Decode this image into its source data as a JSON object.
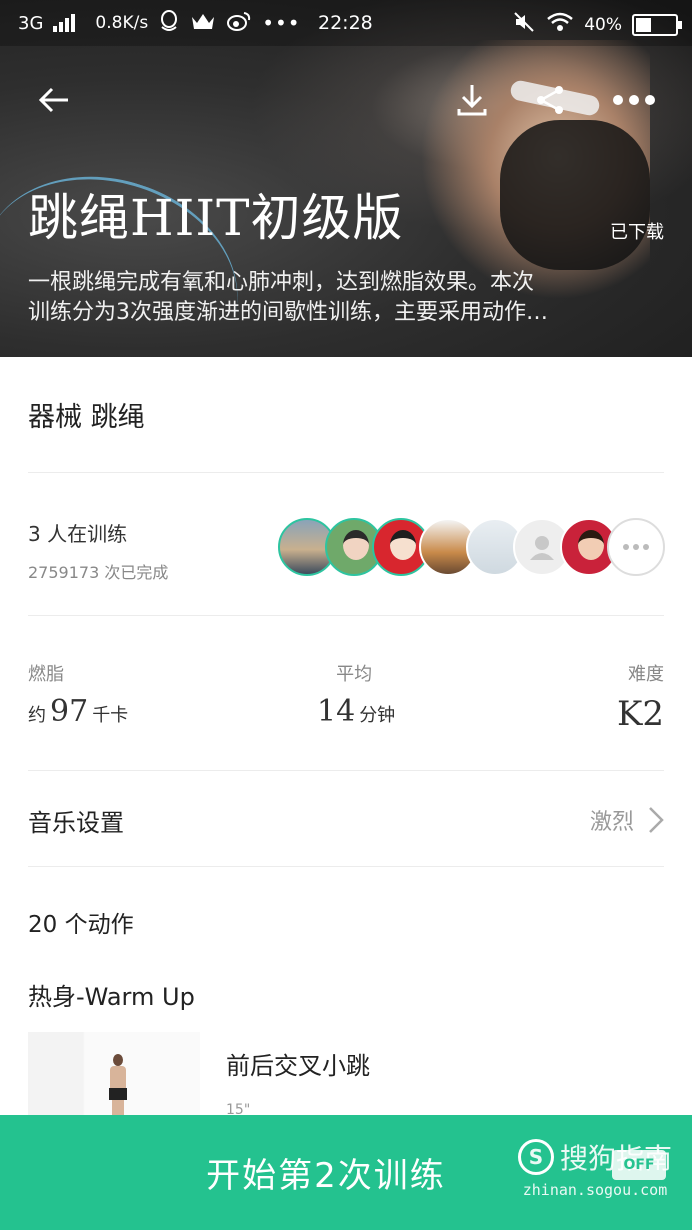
{
  "status_bar": {
    "network": "3G",
    "speed": "0.8K/s",
    "time": "22:28",
    "battery": "40%",
    "battery_level": 0.4,
    "icons": [
      "signal-icon",
      "qq-icon",
      "crown-icon",
      "weibo-icon",
      "more-dots-icon",
      "mute-icon",
      "wifi-icon",
      "battery-icon"
    ]
  },
  "toolbar": {
    "back_icon": "back-arrow-icon",
    "download_icon": "download-icon",
    "share_icon": "share-icon",
    "more_icon": "more-icon"
  },
  "hero": {
    "title": "跳绳HIIT初级版",
    "downloaded": "已下载",
    "desc_line1": "一根跳绳完成有氧和心肺冲刺，达到燃脂效果。本次",
    "desc_line2": "训练分为3次强度渐进的间歇性训练，主要采用动作…"
  },
  "equipment": "器械 跳绳",
  "trainers": {
    "count": "3 人在训练",
    "completed": "2759173 次已完成",
    "avatar_count": 7
  },
  "stats": {
    "burn": {
      "label": "燃脂",
      "prefix": "约",
      "value": "97",
      "unit": "千卡"
    },
    "avg": {
      "label": "平均",
      "value": "14",
      "unit": "分钟"
    },
    "difficulty": {
      "label": "难度",
      "value": "K2"
    }
  },
  "music": {
    "label": "音乐设置",
    "value": "激烈"
  },
  "moves_count": "20 个动作",
  "section_title": "热身-Warm Up",
  "exercise": {
    "name": "前后交叉小跳",
    "duration": "15\""
  },
  "start_button": "开始第2次训练",
  "watermark": {
    "brand": "搜狗指南",
    "url": "zhinan.sogou.com",
    "off": "OFF"
  },
  "colors": {
    "accent": "#24c28f",
    "ring": "#2ec4a0"
  }
}
